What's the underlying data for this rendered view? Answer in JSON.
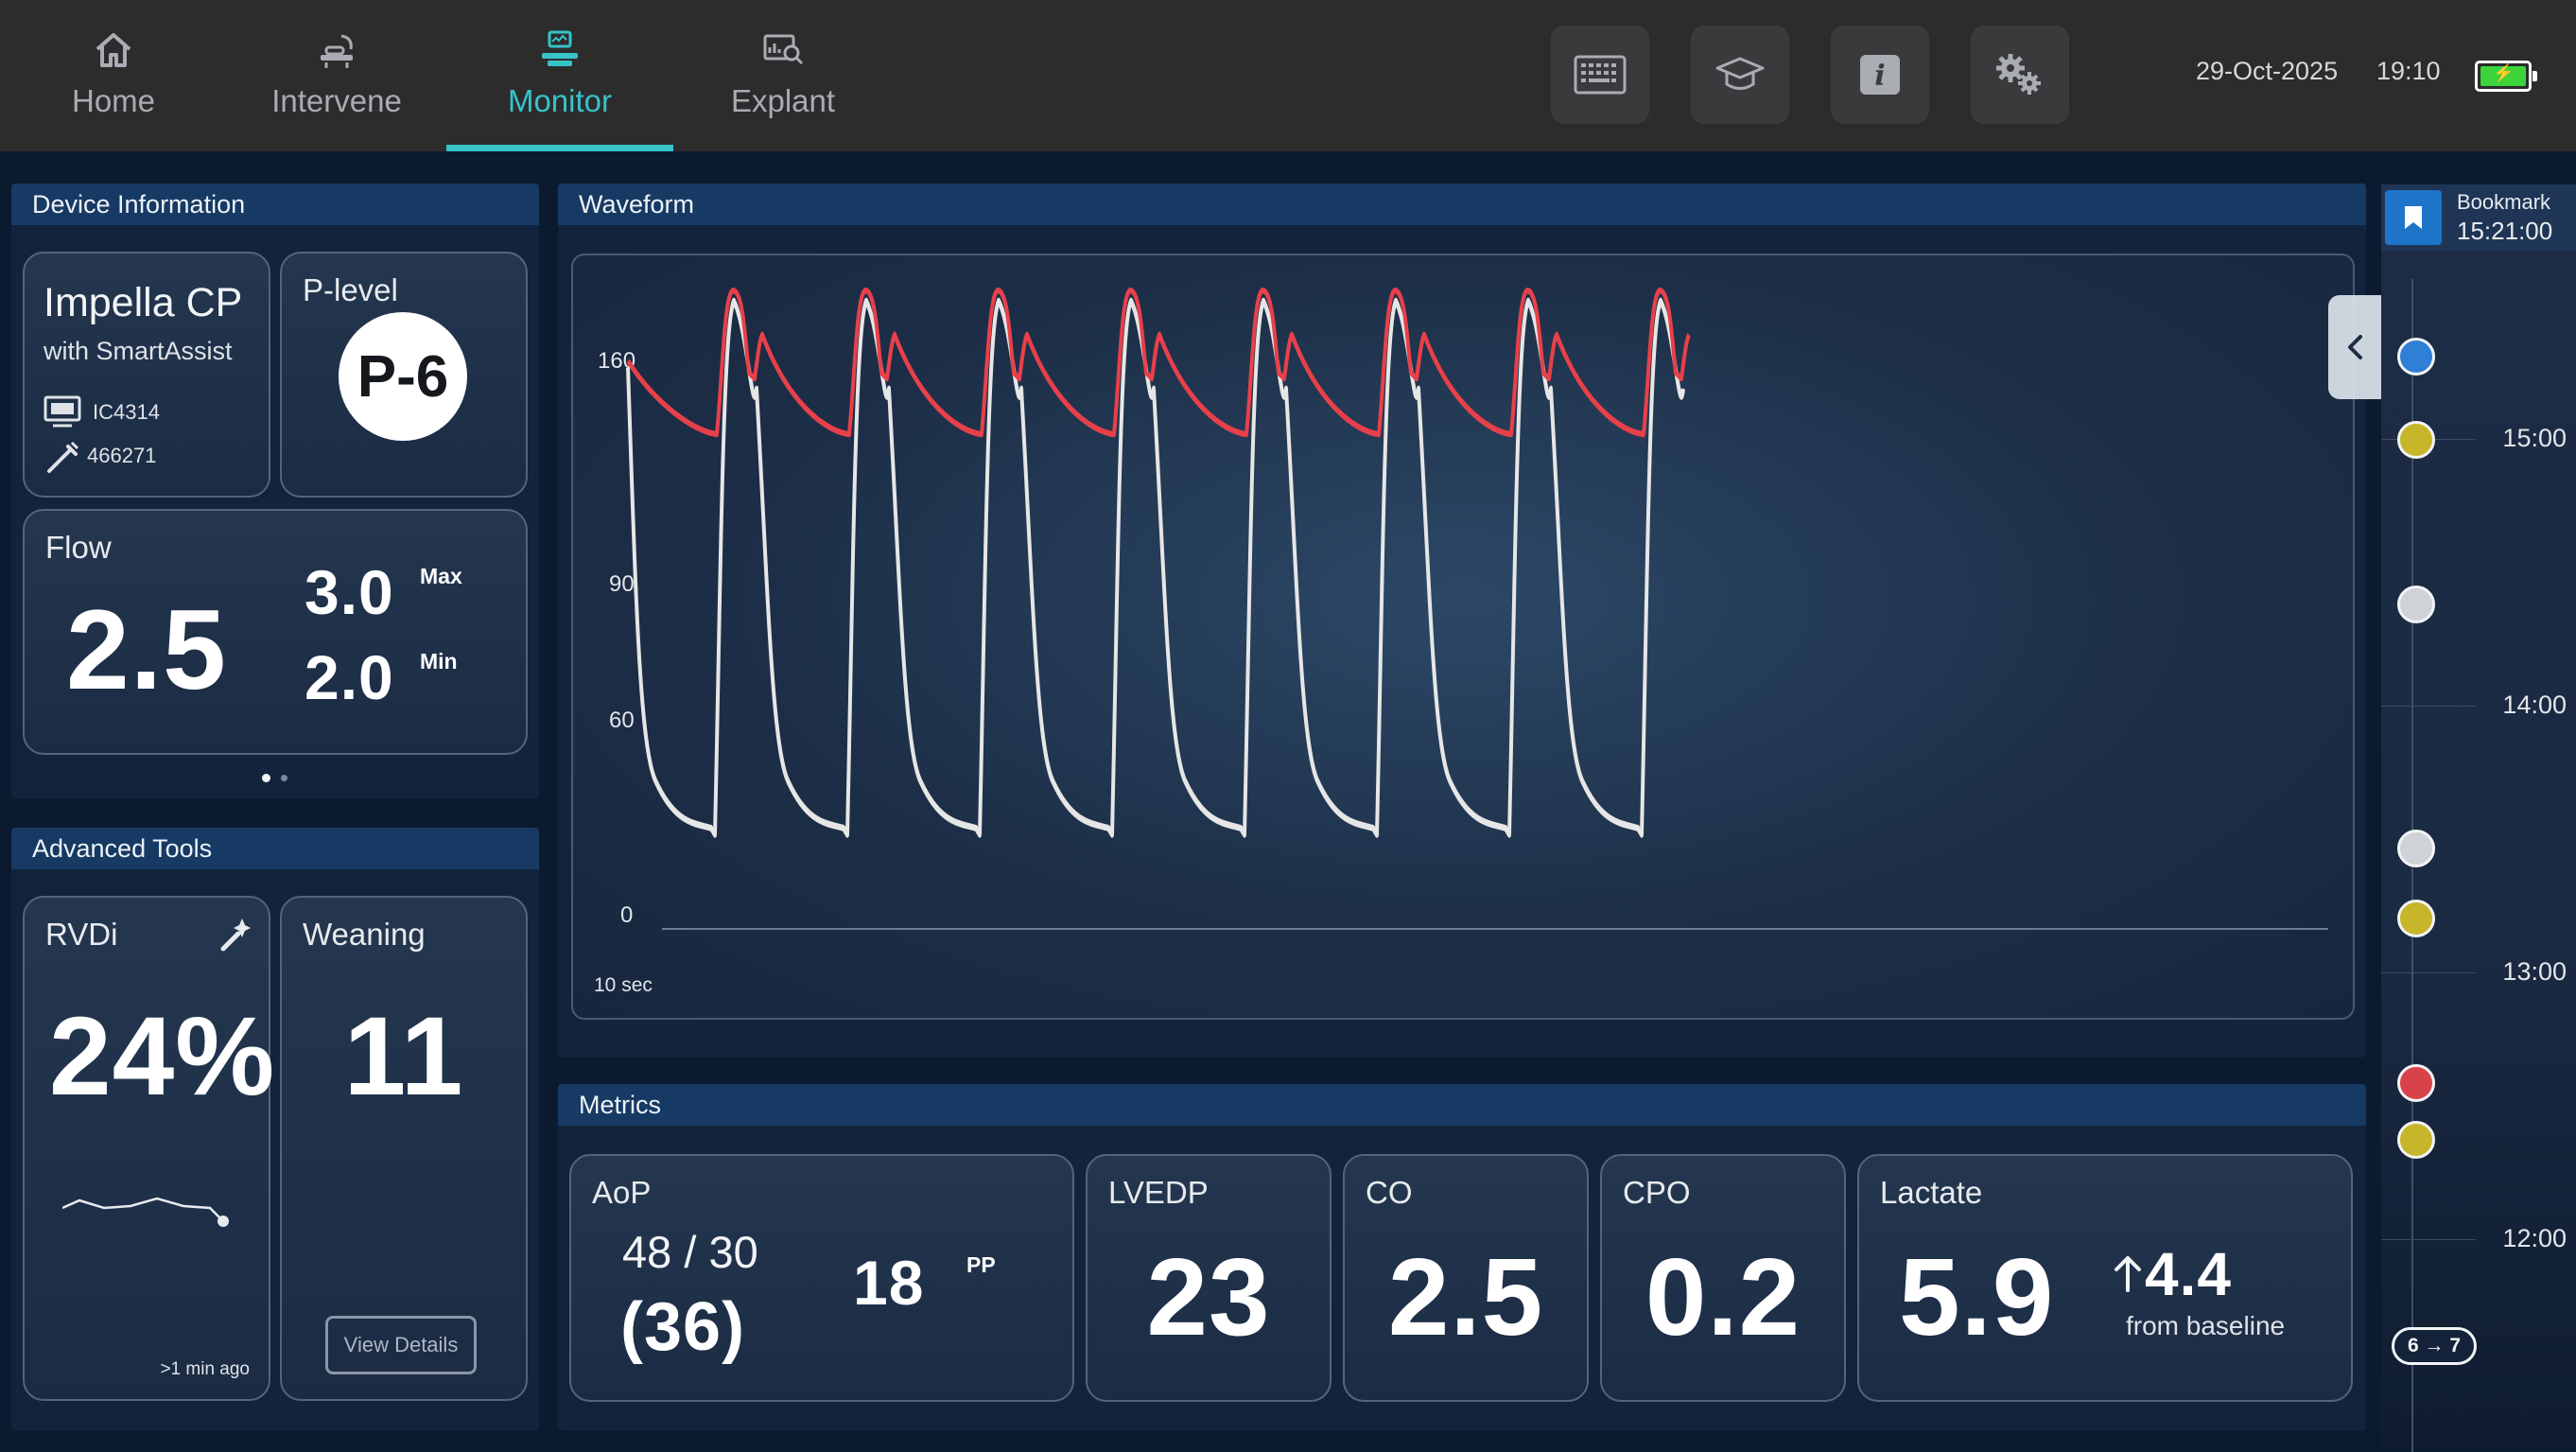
{
  "nav": {
    "tabs": [
      {
        "label": "Home",
        "icon": "home-icon"
      },
      {
        "label": "Intervene",
        "icon": "intervene-icon"
      },
      {
        "label": "Monitor",
        "icon": "monitor-icon",
        "active": true
      },
      {
        "label": "Explant",
        "icon": "explant-icon"
      }
    ],
    "tools": [
      "keyboard-icon",
      "education-icon",
      "info-icon",
      "settings-icon"
    ],
    "date": "29-Oct-2025",
    "time": "19:10",
    "battery_level": 1.0
  },
  "device_info": {
    "header": "Device Information",
    "device_name": "Impella CP",
    "device_sub": "with SmartAssist",
    "console_id": "IC4314",
    "catheter_id": "466271",
    "plevel_label": "P-level",
    "plevel_value": "P-6",
    "flow_label": "Flow",
    "flow_value": "2.5",
    "flow_max": "3.0",
    "flow_max_label": "Max",
    "flow_min": "2.0",
    "flow_min_label": "Min",
    "pager": {
      "pages": 2,
      "active": 1
    }
  },
  "advanced_tools": {
    "header": "Advanced Tools",
    "rvdi_label": "RVDi",
    "rvdi_value": "24%",
    "rvdi_updated": ">1 min ago",
    "weaning_label": "Weaning",
    "weaning_value": "11",
    "view_details": "View Details"
  },
  "waveform": {
    "header": "Waveform",
    "y_ticks": [
      "160",
      "90",
      "60",
      "0"
    ],
    "time_window": "10 sec",
    "colors": {
      "aortic": "#e8404a",
      "ventricular": "#e6e6e6"
    }
  },
  "metrics": {
    "header": "Metrics",
    "aop_label": "AoP",
    "aop_sys_dia": "48 / 30",
    "aop_mean": "(36)",
    "pp_value": "18",
    "pp_label": "PP",
    "lvedp_label": "LVEDP",
    "lvedp_value": "23",
    "co_label": "CO",
    "co_value": "2.5",
    "cpo_label": "CPO",
    "cpo_value": "0.2",
    "lactate_label": "Lactate",
    "lactate_value": "5.9",
    "lactate_delta": "4.4",
    "lactate_delta_text": "from baseline"
  },
  "timeline": {
    "bookmark_label": "Bookmark",
    "bookmark_time": "15:21:00",
    "times": [
      "15:00",
      "14:00",
      "13:00",
      "12:00"
    ],
    "events": [
      {
        "color": "#2f7fd6",
        "name": "event-blue"
      },
      {
        "color": "#c8b62a",
        "name": "event-yellow"
      },
      {
        "color": "#cfd2d6",
        "name": "event-gray"
      },
      {
        "color": "#cfd2d6",
        "name": "event-gray"
      },
      {
        "color": "#c8b62a",
        "name": "event-yellow"
      },
      {
        "color": "#d8434a",
        "name": "event-red"
      },
      {
        "color": "#c8b62a",
        "name": "event-yellow"
      }
    ],
    "plevel_change": "6 → 7"
  }
}
